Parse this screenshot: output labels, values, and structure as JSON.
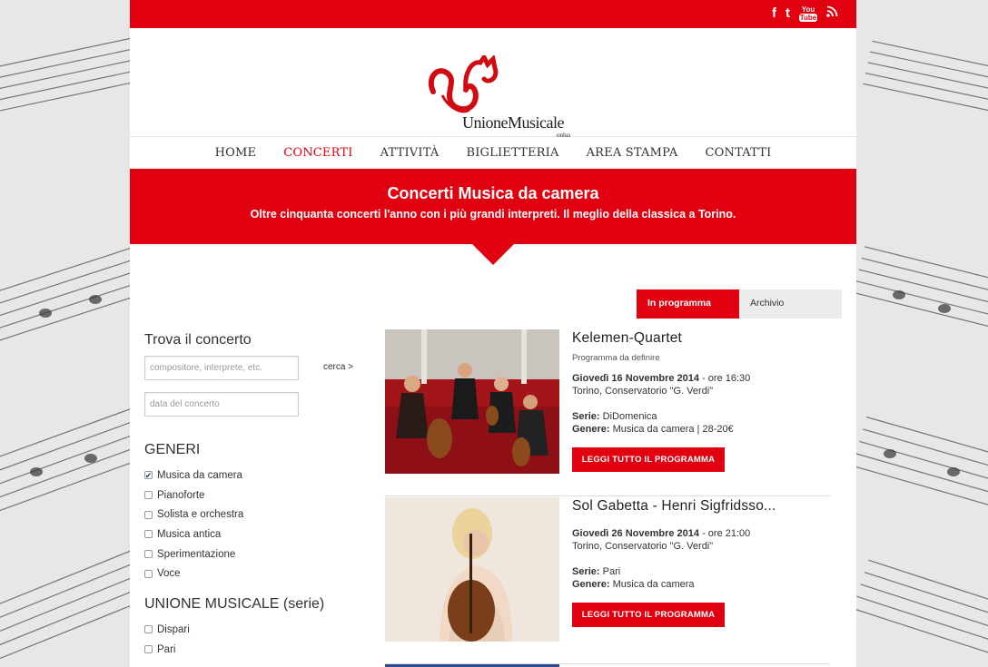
{
  "header": {
    "social": [
      "f",
      "t",
      "YouTube",
      "rss"
    ],
    "logo": {
      "name": "UnioneMusicale",
      "sub": "onlus"
    }
  },
  "nav": {
    "items": [
      "HOME",
      "CONCERTI",
      "ATTIVITÀ",
      "BIGLIETTERIA",
      "AREA STAMPA",
      "CONTATTI"
    ],
    "active": "CONCERTI"
  },
  "hero": {
    "title": "Concerti Musica da camera",
    "subtitle": "Oltre cinquanta concerti l'anno con i più grandi interpreti. Il meglio della classica a Torino."
  },
  "tabs": {
    "in_programma": "In programma",
    "archivio": "Archivio"
  },
  "sidebar": {
    "search_title": "Trova il concerto",
    "search_placeholder": "compositore, interprete, etc.",
    "search_button": "cerca >",
    "date_placeholder": "data del concerto",
    "generi_title": "GENERI",
    "generi": [
      {
        "label": "Musica da camera",
        "checked": true
      },
      {
        "label": "Pianoforte",
        "checked": false
      },
      {
        "label": "Solista e orchestra",
        "checked": false
      },
      {
        "label": "Musica antica",
        "checked": false
      },
      {
        "label": "Sperimentazione",
        "checked": false
      },
      {
        "label": "Voce",
        "checked": false
      }
    ],
    "serie_title": "UNIONE MUSICALE (serie)",
    "serie": [
      {
        "label": "Dispari",
        "checked": false
      },
      {
        "label": "Pari",
        "checked": false
      }
    ]
  },
  "concerts": [
    {
      "title": "Kelemen-Quartet",
      "program": "Programma da definire",
      "date": "Giovedì 16 Novembre 2014",
      "time": " - ore 16:30",
      "venue": "Torino, Conservatorio \"G. Verdi\"",
      "serie_label": "Serie:",
      "serie": " DiDomenica",
      "genere_label": "Genere:",
      "genere": " Musica da camera | 28-20€",
      "button": "LEGGI TUTTO IL PROGRAMMA"
    },
    {
      "title": "Sol Gabetta - Henri Sigfridsso...",
      "program": "",
      "date": "Giovedì 26 Novembre 2014",
      "time": " - ore 21:00",
      "venue": "Torino, Conservatorio \"G. Verdi\"",
      "serie_label": "Serie:",
      "serie": " Pari",
      "genere_label": "Genere:",
      "genere": " Musica da camera",
      "button": "LEGGI TUTTO IL PROGRAMMA"
    }
  ],
  "colors": {
    "accent": "#e1000f",
    "text": "#333333",
    "tab_off": "#ececec"
  }
}
